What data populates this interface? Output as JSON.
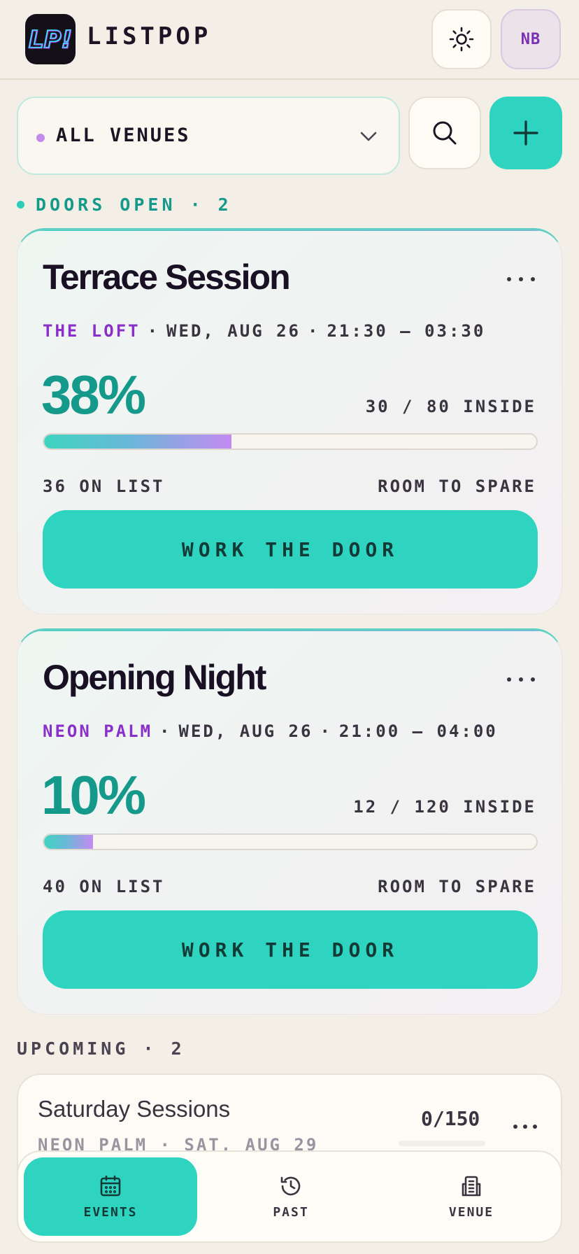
{
  "app": {
    "logo_text": "LP!",
    "name": "LISTPOP",
    "theme_icon": "sun-icon",
    "avatar_initials": "NB"
  },
  "filter": {
    "venue_label": "ALL VENUES",
    "venue_dot_color": "#c48be8",
    "chevron_icon": "chevron-down-icon",
    "search_icon": "search-icon",
    "add_icon": "plus-icon"
  },
  "sections": {
    "live": "DOORS OPEN · 2",
    "upcoming": "UPCOMING · 2"
  },
  "events": [
    {
      "title": "Terrace Session",
      "venue": "THE LOFT",
      "date": "WED, AUG 26",
      "time": "21:30 — 03:30",
      "sep": "·",
      "percent": "38%",
      "fill": 0.38,
      "inside": "30 / 80 INSIDE",
      "on_list": "36 ON LIST",
      "status": "ROOM TO SPARE",
      "action": "WORK THE DOOR"
    },
    {
      "title": "Opening Night",
      "venue": "NEON PALM",
      "date": "WED, AUG 26",
      "time": "21:00 — 04:00",
      "sep": "·",
      "percent": "10%",
      "fill": 0.1,
      "inside": "12 / 120 INSIDE",
      "on_list": "40 ON LIST",
      "status": "ROOM TO SPARE",
      "action": "WORK THE DOOR"
    }
  ],
  "upcoming": [
    {
      "title": "Saturday Sessions",
      "meta": "NEON PALM · SAT, AUG 29",
      "count": "0/150"
    }
  ],
  "nav": [
    {
      "label": "EVENTS",
      "icon": "calendar-icon",
      "active": true
    },
    {
      "label": "PAST",
      "icon": "history-icon",
      "active": false
    },
    {
      "label": "VENUE",
      "icon": "building-icon",
      "active": false
    }
  ],
  "colors": {
    "accent": "#2fd4c0",
    "accent_text": "#14998a",
    "venue_purple": "#8a2fc9",
    "background": "#f4efe6"
  }
}
